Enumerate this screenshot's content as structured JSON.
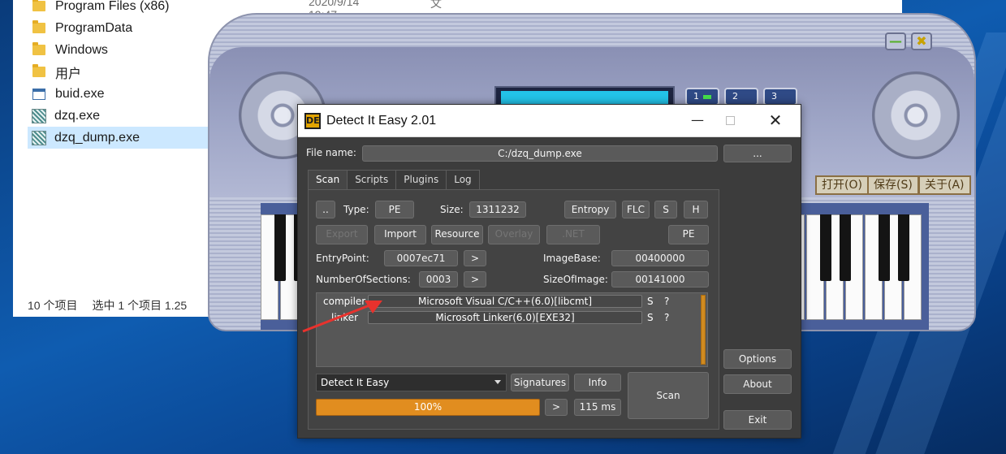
{
  "explorer": {
    "files": [
      {
        "name": "Program Files (x86)",
        "icon": "folder-icon",
        "date": "2020/9/14 19:47",
        "type": "文件夹"
      },
      {
        "name": "ProgramData",
        "icon": "folder-icon"
      },
      {
        "name": "Windows",
        "icon": "folder-icon"
      },
      {
        "name": "用户",
        "icon": "folder-icon"
      },
      {
        "name": "buid.exe",
        "icon": "exe-icon"
      },
      {
        "name": "dzq.exe",
        "icon": "app-icon"
      },
      {
        "name": "dzq_dump.exe",
        "icon": "app-icon",
        "selected": true
      }
    ],
    "status": {
      "count": "10 个项目",
      "selected": "选中 1 个项目  1.25"
    }
  },
  "piano": {
    "preset_buttons": [
      "1",
      "2",
      "3"
    ],
    "skin_buttons": [
      "打开(O)",
      "保存(S)",
      "关于(A)"
    ],
    "minimize_glyph": "—",
    "close_glyph": "✖"
  },
  "die": {
    "title": "Detect It Easy 2.01",
    "file_label": "File name:",
    "file_value": "C:/dzq_dump.exe",
    "browse_label": "...",
    "tabs": [
      "Scan",
      "Scripts",
      "Plugins",
      "Log"
    ],
    "dotdot": "..",
    "type_label": "Type:",
    "type_value": "PE",
    "size_label": "Size:",
    "size_value": "1311232",
    "buttons": {
      "entropy": "Entropy",
      "flc": "FLC",
      "s": "S",
      "h": "H",
      "export": "Export",
      "import": "Import",
      "resource": "Resource",
      "overlay": "Overlay",
      "net": ".NET",
      "pe": "PE",
      "entry_next": ">",
      "sections_next": ">",
      "signatures": "Signatures",
      "info": "Info",
      "scan": "Scan",
      "progress_next": ">",
      "options": "Options",
      "about": "About",
      "exit": "Exit"
    },
    "entrypoint_label": "EntryPoint:",
    "entrypoint_value": "0007ec71",
    "imagebase_label": "ImageBase:",
    "imagebase_value": "00400000",
    "sections_label": "NumberOfSections:",
    "sections_value": "0003",
    "sizeofimage_label": "SizeOfImage:",
    "sizeofimage_value": "00141000",
    "results": [
      {
        "type": "compiler",
        "value": "Microsoft Visual C/C++(6.0)[libcmt]",
        "s": "S",
        "q": "?"
      },
      {
        "type": "linker",
        "value": "Microsoft Linker(6.0)[EXE32]",
        "s": "S",
        "q": "?"
      }
    ],
    "engine": "Detect It Easy",
    "progress_text": "100%",
    "progress_fraction": 1.0,
    "time": "115 ms"
  },
  "colors": {
    "accent": "#d8851b",
    "annotation": "#e8322d"
  }
}
